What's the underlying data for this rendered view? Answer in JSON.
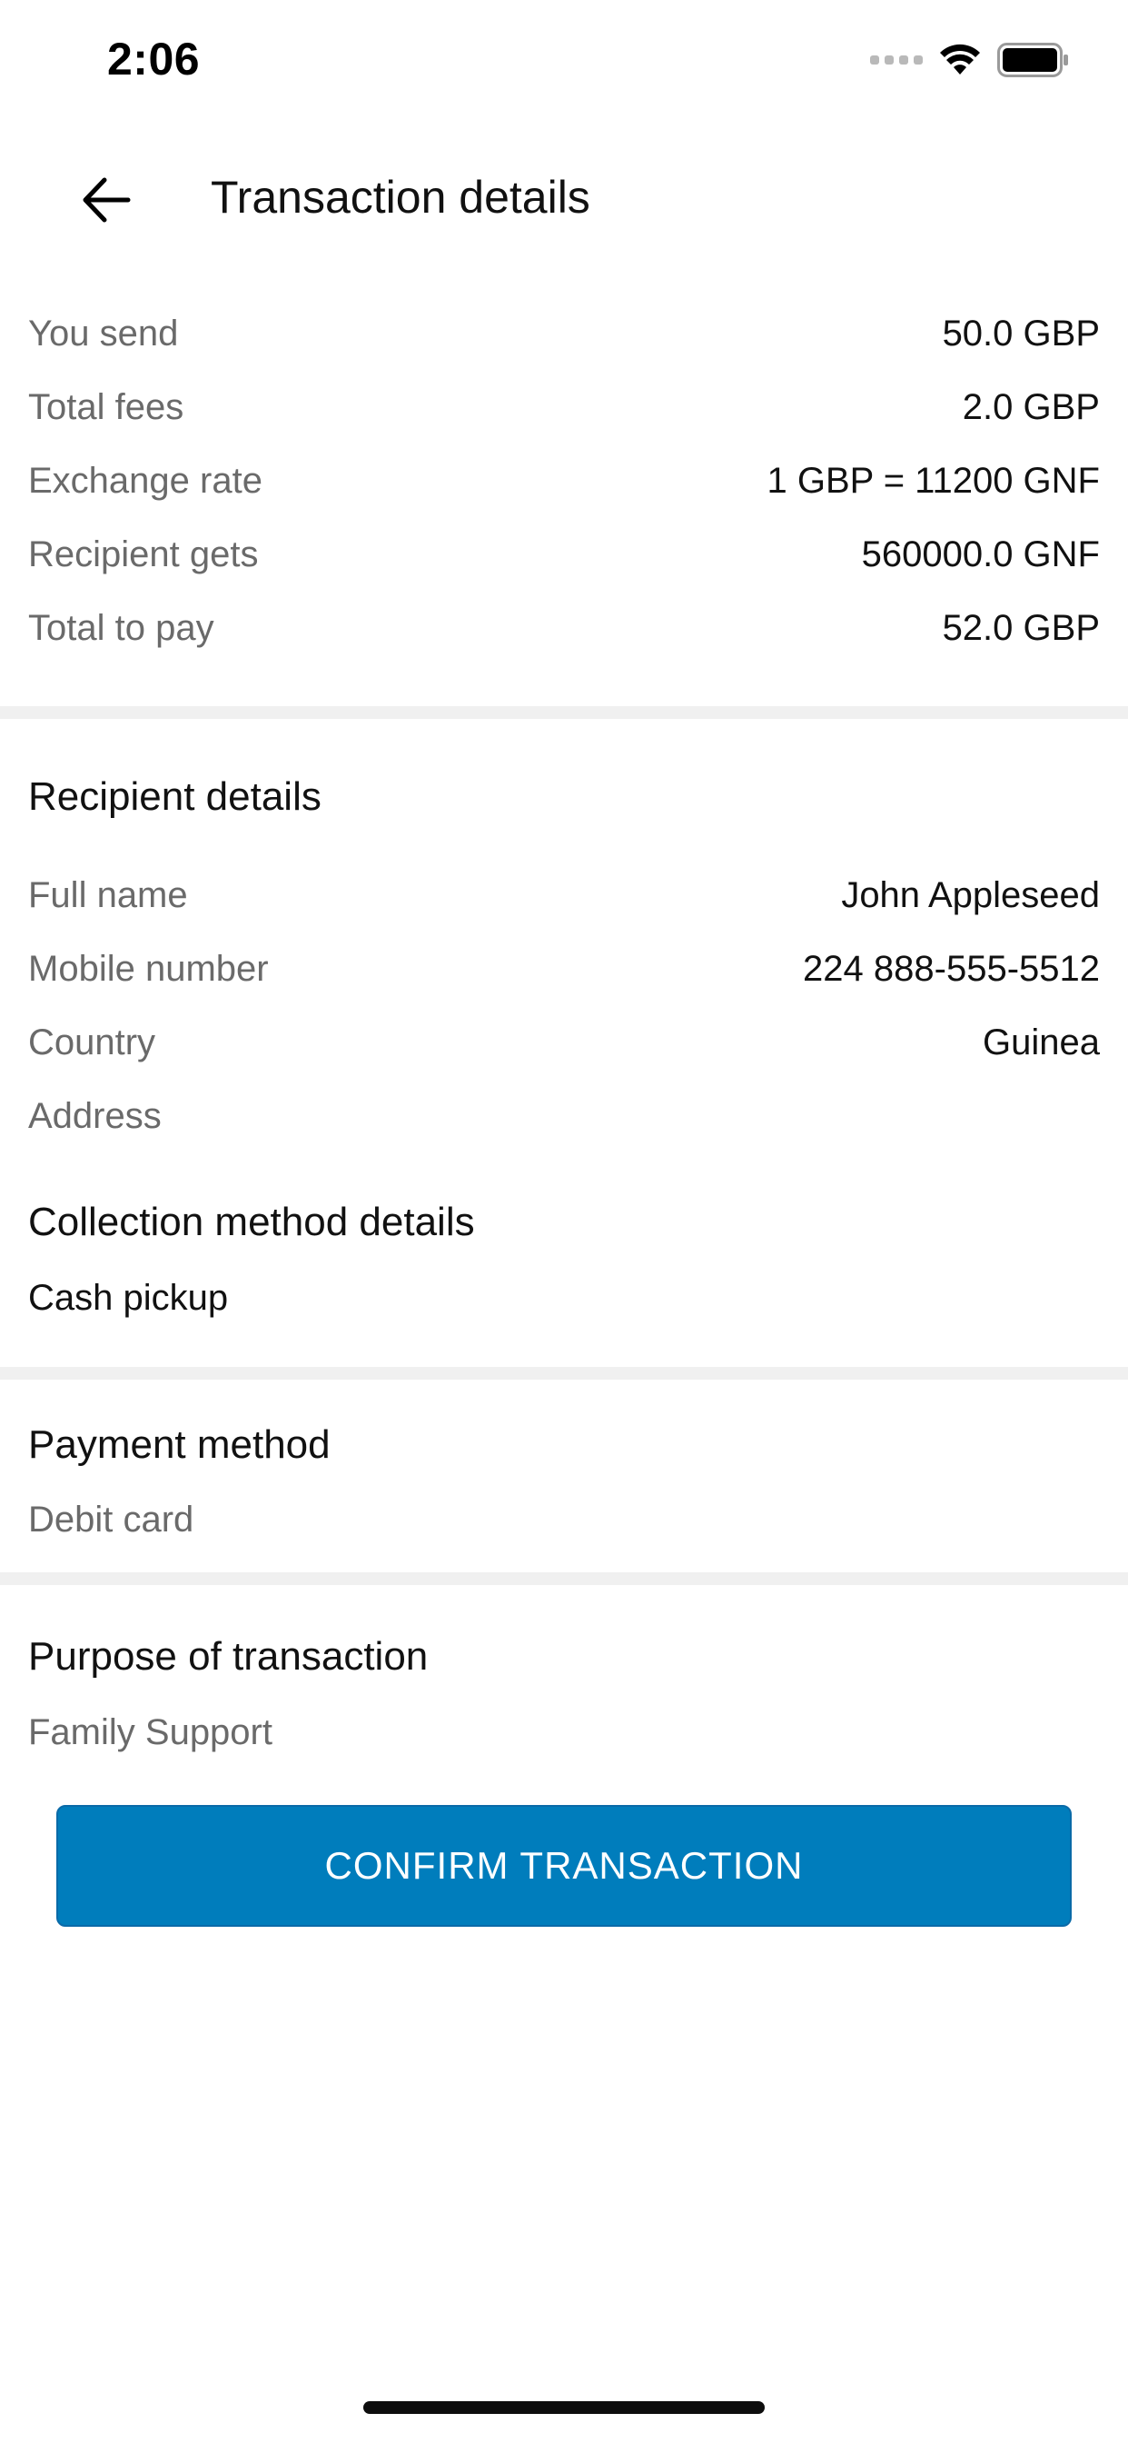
{
  "status_bar": {
    "time": "2:06"
  },
  "header": {
    "title": "Transaction details",
    "back_icon": "arrow-left-icon"
  },
  "summary": [
    {
      "label": "You send",
      "value": "50.0 GBP"
    },
    {
      "label": "Total fees",
      "value": "2.0 GBP"
    },
    {
      "label": "Exchange rate",
      "value": "1 GBP = 11200 GNF"
    },
    {
      "label": "Recipient gets",
      "value": "560000.0 GNF"
    },
    {
      "label": "Total to pay",
      "value": "52.0 GBP"
    }
  ],
  "recipient": {
    "title": "Recipient details",
    "rows": [
      {
        "label": "Full name",
        "value": "John Appleseed"
      },
      {
        "label": "Mobile number",
        "value": "224 888-555-5512"
      },
      {
        "label": "Country",
        "value": "Guinea"
      },
      {
        "label": "Address",
        "value": ""
      }
    ]
  },
  "collection": {
    "title": "Collection method details",
    "value": "Cash pickup"
  },
  "payment": {
    "title": "Payment method",
    "value": "Debit card"
  },
  "purpose": {
    "title": "Purpose of transaction",
    "value": "Family Support"
  },
  "confirm_button": {
    "label": "CONFIRM TRANSACTION"
  },
  "colors": {
    "accent": "#007dbc",
    "label_gray": "#6a6a6a",
    "divider": "#f0f0f0"
  }
}
